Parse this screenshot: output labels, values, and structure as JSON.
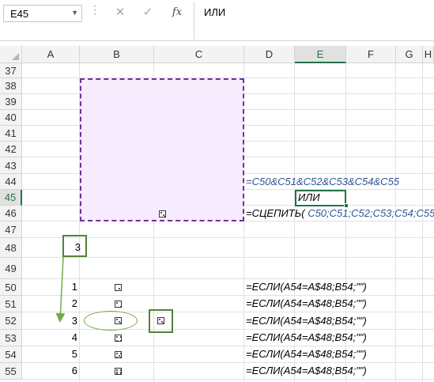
{
  "formula_bar": {
    "name_box": "E45",
    "formula": "ИЛИ",
    "fx_label": "fx"
  },
  "columns": [
    "A",
    "B",
    "C",
    "D",
    "E",
    "F",
    "G",
    "H"
  ],
  "rows": [
    "37",
    "38",
    "39",
    "40",
    "41",
    "42",
    "43",
    "44",
    "45",
    "46",
    "47",
    "48",
    "49",
    "50",
    "51",
    "52",
    "53",
    "54",
    "55"
  ],
  "cells": {
    "D44": "=C50&C51&C52&C53&C54&C55",
    "E45": "ИЛИ",
    "D46_prefix": "=СЦЕПИТЬ(",
    "D46_args": "C50;C51;C52;C53;C54;C55",
    "D46_suffix": ")",
    "A48": "3",
    "A50": "1",
    "A51": "2",
    "A52": "3",
    "A53": "4",
    "A54": "5",
    "A55": "6",
    "D50": "=ЕСЛИ(A54=A$48;B54;\"\")",
    "D51": "=ЕСЛИ(A54=A$48;B54;\"\")",
    "D52": "=ЕСЛИ(A54=A$48;B54;\"\")",
    "D53": "=ЕСЛИ(A54=A$48;B54;\"\")",
    "D54": "=ЕСЛИ(A54=A$48;B54;\"\")",
    "D55": "=ЕСЛИ(A54=A$48;B54;\"\")"
  },
  "dice_faces": {
    "B46": 3,
    "B50": 1,
    "B51": 2,
    "B52": 3,
    "B53": 4,
    "B54": 5,
    "B55": 6,
    "C52": 3
  },
  "colors": {
    "selection_green": "#217346",
    "annotation_green": "#548235",
    "purple_border": "#7030a0",
    "purple_fill": "#f7ecfd",
    "formula_blue": "#2f5597"
  }
}
